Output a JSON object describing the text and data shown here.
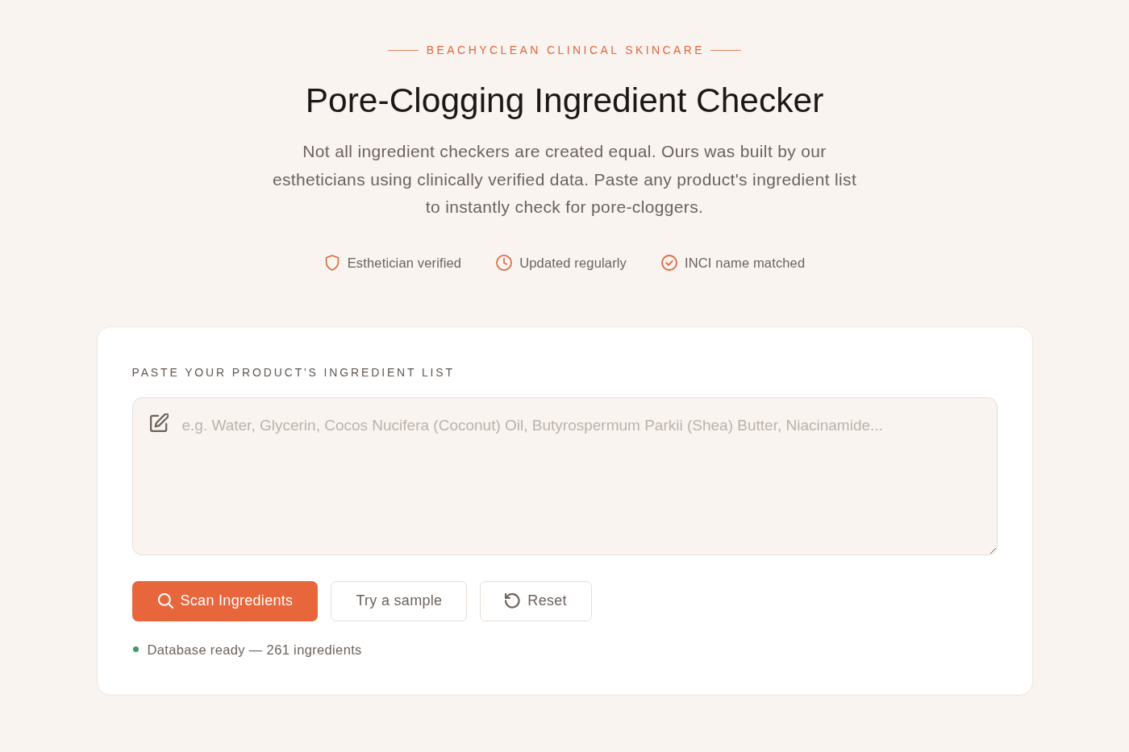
{
  "header": {
    "eyebrow": "BEACHYCLEAN CLINICAL SKINCARE",
    "title": "Pore-Clogging Ingredient Checker",
    "intro": "Not all ingredient checkers are created equal. Ours was built by our estheticians using clinically verified data. Paste any product's ingredient list to instantly check for pore-cloggers."
  },
  "badges": [
    {
      "kind": "shield",
      "label": "Esthetician verified"
    },
    {
      "kind": "clock",
      "label": "Updated regularly"
    },
    {
      "kind": "check",
      "label": "INCI name matched"
    }
  ],
  "checker": {
    "label": "PASTE YOUR PRODUCT'S INGREDIENT LIST",
    "input": {
      "placeholder": "e.g. Water, Glycerin, Cocos Nucifera (Coconut) Oil, Butyrospermum Parkii (Shea) Butter, Niacinamide..."
    },
    "buttons": [
      {
        "kind": "primary",
        "label": "Scan Ingredients"
      },
      {
        "kind": "plain",
        "label": "Try a sample"
      },
      {
        "kind": "reset",
        "label": "Reset"
      }
    ],
    "status": {
      "ready": true,
      "text": "Database ready — 261 ingredients"
    }
  }
}
